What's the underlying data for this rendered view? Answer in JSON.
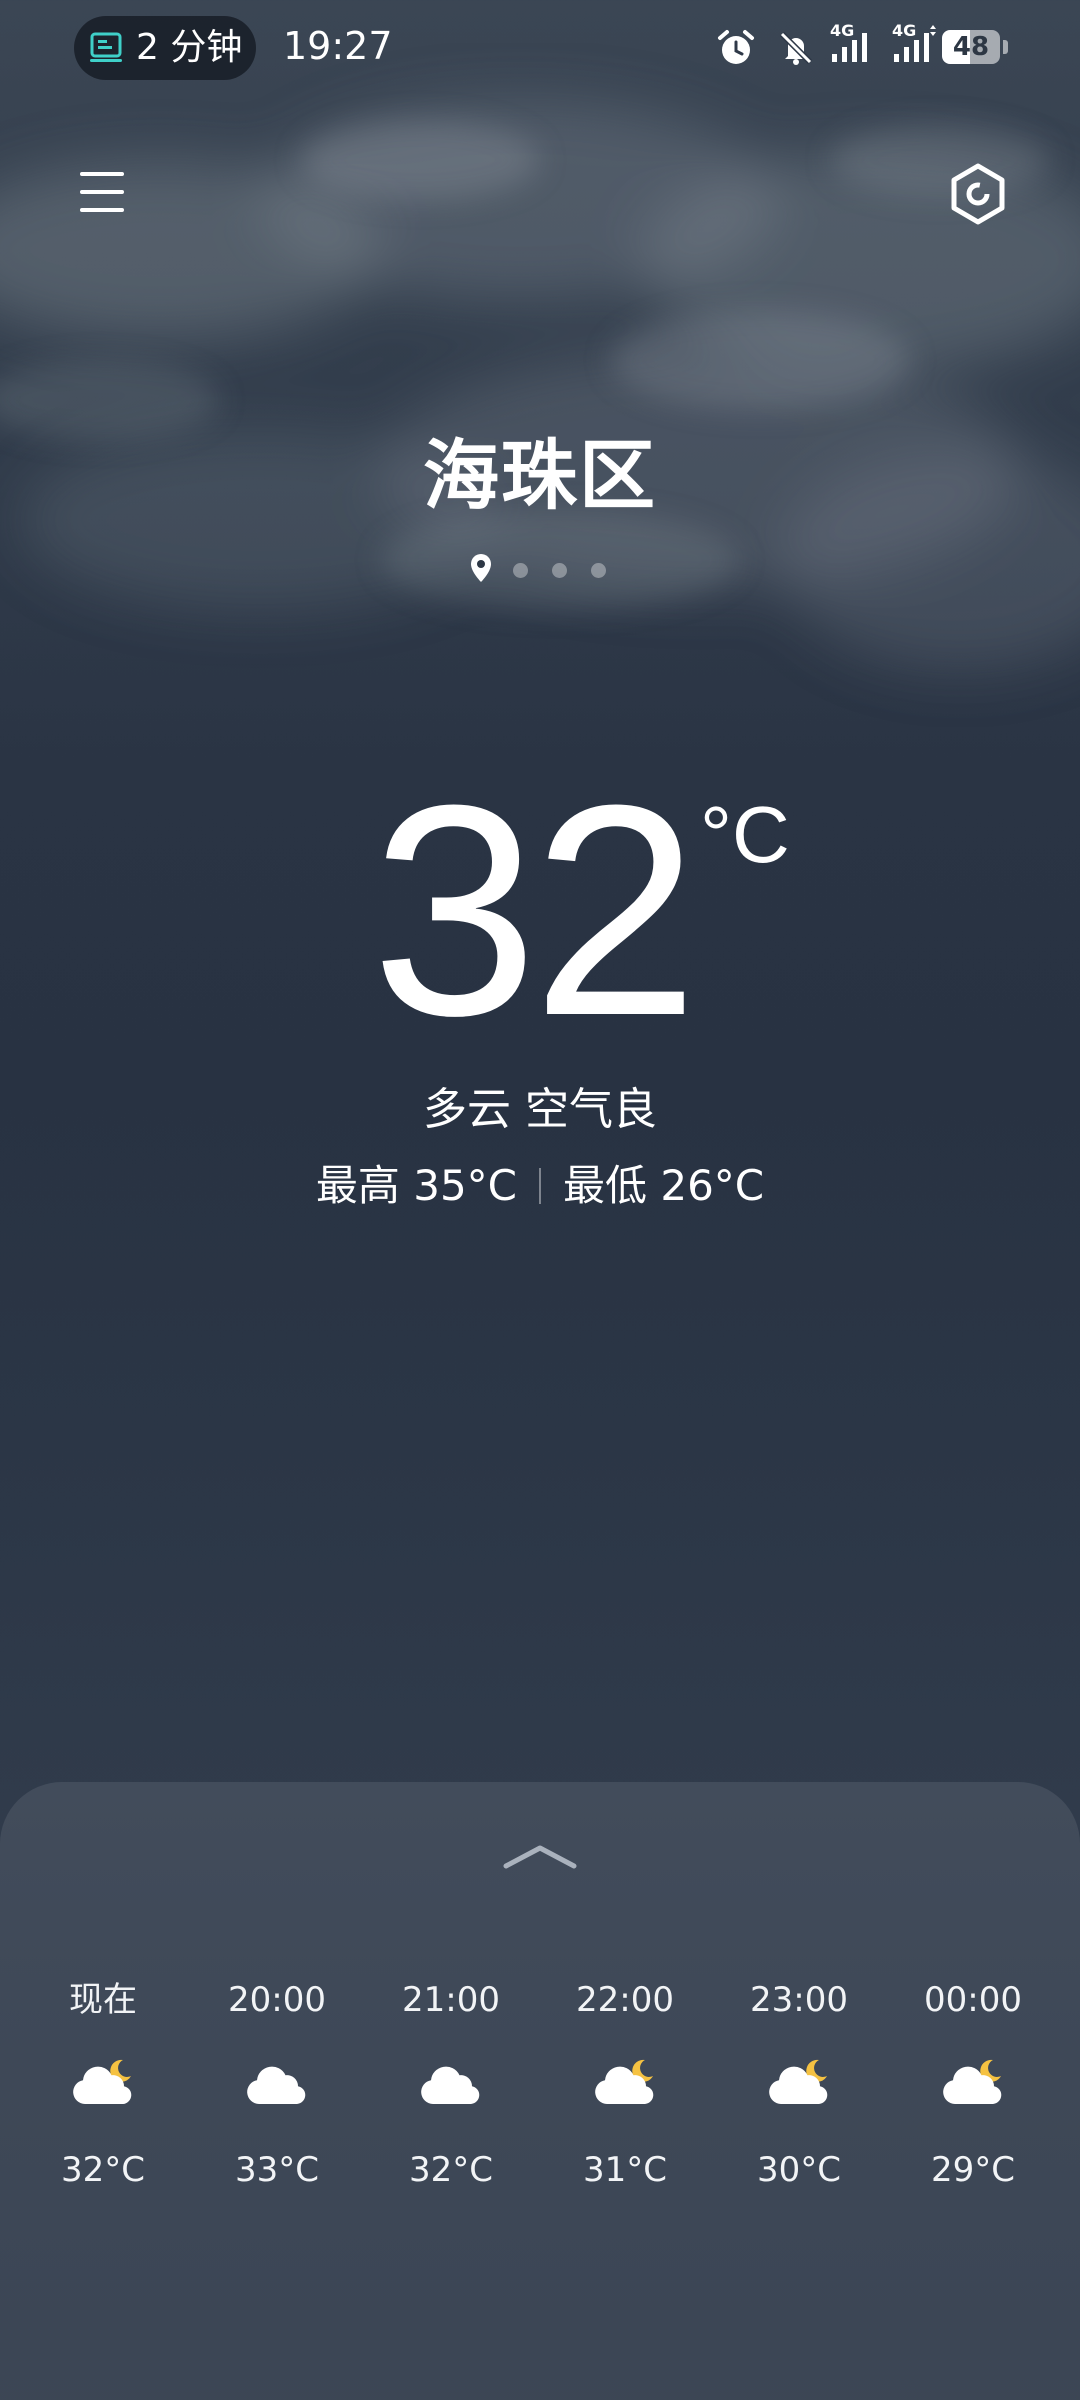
{
  "status_bar": {
    "screen_time_icon": "screen-time-icon",
    "screen_time_label": "2 分钟",
    "clock": "19:27",
    "icons": [
      "alarm-icon",
      "mute-bell-icon",
      "signal-4g-icon",
      "signal-4g-data-icon"
    ],
    "signal_label_1": "4G",
    "signal_label_2": "4G",
    "battery_level": "48",
    "battery_percent": 48
  },
  "header": {
    "menu_icon": "hamburger-menu-icon",
    "settings_icon": "hexagon-settings-icon"
  },
  "location": {
    "city": "海珠区",
    "pages": 4,
    "active_page": 0
  },
  "current": {
    "temperature": "32",
    "unit": "°C",
    "condition": "多云 空气良",
    "high": "最高 35°C",
    "low": "最低 26°C"
  },
  "hourly": [
    {
      "time": "现在",
      "icon": "cloud-moon-icon",
      "temp": "32°C"
    },
    {
      "time": "20:00",
      "icon": "cloud-icon",
      "temp": "33°C"
    },
    {
      "time": "21:00",
      "icon": "cloud-icon",
      "temp": "32°C"
    },
    {
      "time": "22:00",
      "icon": "cloud-moon-icon",
      "temp": "31°C"
    },
    {
      "time": "23:00",
      "icon": "cloud-moon-icon",
      "temp": "30°C"
    },
    {
      "time": "00:00",
      "icon": "cloud-moon-icon",
      "temp": "29°C"
    }
  ],
  "colors": {
    "moon": "#f5c242",
    "cloud": "#ffffff",
    "background_top": "#3b4654",
    "background_mid": "#283242"
  }
}
